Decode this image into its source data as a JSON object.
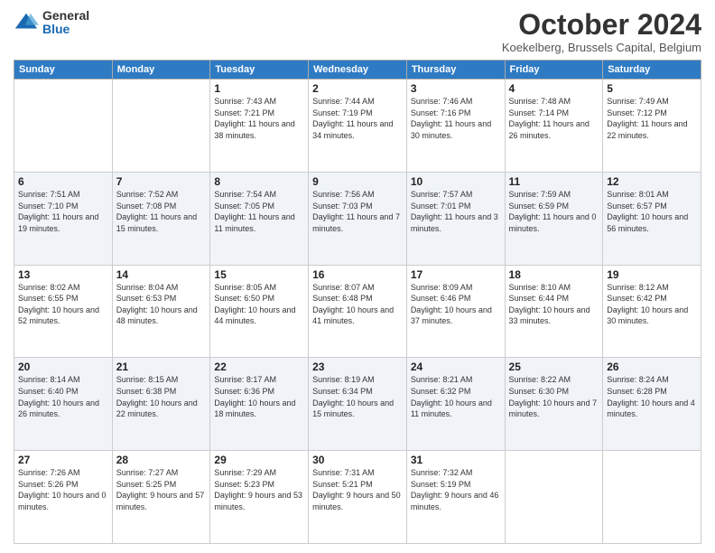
{
  "header": {
    "logo_general": "General",
    "logo_blue": "Blue",
    "month_title": "October 2024",
    "location": "Koekelberg, Brussels Capital, Belgium"
  },
  "weekdays": [
    "Sunday",
    "Monday",
    "Tuesday",
    "Wednesday",
    "Thursday",
    "Friday",
    "Saturday"
  ],
  "weeks": [
    [
      {
        "day": "",
        "sunrise": "",
        "sunset": "",
        "daylight": ""
      },
      {
        "day": "",
        "sunrise": "",
        "sunset": "",
        "daylight": ""
      },
      {
        "day": "1",
        "sunrise": "Sunrise: 7:43 AM",
        "sunset": "Sunset: 7:21 PM",
        "daylight": "Daylight: 11 hours and 38 minutes."
      },
      {
        "day": "2",
        "sunrise": "Sunrise: 7:44 AM",
        "sunset": "Sunset: 7:19 PM",
        "daylight": "Daylight: 11 hours and 34 minutes."
      },
      {
        "day": "3",
        "sunrise": "Sunrise: 7:46 AM",
        "sunset": "Sunset: 7:16 PM",
        "daylight": "Daylight: 11 hours and 30 minutes."
      },
      {
        "day": "4",
        "sunrise": "Sunrise: 7:48 AM",
        "sunset": "Sunset: 7:14 PM",
        "daylight": "Daylight: 11 hours and 26 minutes."
      },
      {
        "day": "5",
        "sunrise": "Sunrise: 7:49 AM",
        "sunset": "Sunset: 7:12 PM",
        "daylight": "Daylight: 11 hours and 22 minutes."
      }
    ],
    [
      {
        "day": "6",
        "sunrise": "Sunrise: 7:51 AM",
        "sunset": "Sunset: 7:10 PM",
        "daylight": "Daylight: 11 hours and 19 minutes."
      },
      {
        "day": "7",
        "sunrise": "Sunrise: 7:52 AM",
        "sunset": "Sunset: 7:08 PM",
        "daylight": "Daylight: 11 hours and 15 minutes."
      },
      {
        "day": "8",
        "sunrise": "Sunrise: 7:54 AM",
        "sunset": "Sunset: 7:05 PM",
        "daylight": "Daylight: 11 hours and 11 minutes."
      },
      {
        "day": "9",
        "sunrise": "Sunrise: 7:56 AM",
        "sunset": "Sunset: 7:03 PM",
        "daylight": "Daylight: 11 hours and 7 minutes."
      },
      {
        "day": "10",
        "sunrise": "Sunrise: 7:57 AM",
        "sunset": "Sunset: 7:01 PM",
        "daylight": "Daylight: 11 hours and 3 minutes."
      },
      {
        "day": "11",
        "sunrise": "Sunrise: 7:59 AM",
        "sunset": "Sunset: 6:59 PM",
        "daylight": "Daylight: 11 hours and 0 minutes."
      },
      {
        "day": "12",
        "sunrise": "Sunrise: 8:01 AM",
        "sunset": "Sunset: 6:57 PM",
        "daylight": "Daylight: 10 hours and 56 minutes."
      }
    ],
    [
      {
        "day": "13",
        "sunrise": "Sunrise: 8:02 AM",
        "sunset": "Sunset: 6:55 PM",
        "daylight": "Daylight: 10 hours and 52 minutes."
      },
      {
        "day": "14",
        "sunrise": "Sunrise: 8:04 AM",
        "sunset": "Sunset: 6:53 PM",
        "daylight": "Daylight: 10 hours and 48 minutes."
      },
      {
        "day": "15",
        "sunrise": "Sunrise: 8:05 AM",
        "sunset": "Sunset: 6:50 PM",
        "daylight": "Daylight: 10 hours and 44 minutes."
      },
      {
        "day": "16",
        "sunrise": "Sunrise: 8:07 AM",
        "sunset": "Sunset: 6:48 PM",
        "daylight": "Daylight: 10 hours and 41 minutes."
      },
      {
        "day": "17",
        "sunrise": "Sunrise: 8:09 AM",
        "sunset": "Sunset: 6:46 PM",
        "daylight": "Daylight: 10 hours and 37 minutes."
      },
      {
        "day": "18",
        "sunrise": "Sunrise: 8:10 AM",
        "sunset": "Sunset: 6:44 PM",
        "daylight": "Daylight: 10 hours and 33 minutes."
      },
      {
        "day": "19",
        "sunrise": "Sunrise: 8:12 AM",
        "sunset": "Sunset: 6:42 PM",
        "daylight": "Daylight: 10 hours and 30 minutes."
      }
    ],
    [
      {
        "day": "20",
        "sunrise": "Sunrise: 8:14 AM",
        "sunset": "Sunset: 6:40 PM",
        "daylight": "Daylight: 10 hours and 26 minutes."
      },
      {
        "day": "21",
        "sunrise": "Sunrise: 8:15 AM",
        "sunset": "Sunset: 6:38 PM",
        "daylight": "Daylight: 10 hours and 22 minutes."
      },
      {
        "day": "22",
        "sunrise": "Sunrise: 8:17 AM",
        "sunset": "Sunset: 6:36 PM",
        "daylight": "Daylight: 10 hours and 18 minutes."
      },
      {
        "day": "23",
        "sunrise": "Sunrise: 8:19 AM",
        "sunset": "Sunset: 6:34 PM",
        "daylight": "Daylight: 10 hours and 15 minutes."
      },
      {
        "day": "24",
        "sunrise": "Sunrise: 8:21 AM",
        "sunset": "Sunset: 6:32 PM",
        "daylight": "Daylight: 10 hours and 11 minutes."
      },
      {
        "day": "25",
        "sunrise": "Sunrise: 8:22 AM",
        "sunset": "Sunset: 6:30 PM",
        "daylight": "Daylight: 10 hours and 7 minutes."
      },
      {
        "day": "26",
        "sunrise": "Sunrise: 8:24 AM",
        "sunset": "Sunset: 6:28 PM",
        "daylight": "Daylight: 10 hours and 4 minutes."
      }
    ],
    [
      {
        "day": "27",
        "sunrise": "Sunrise: 7:26 AM",
        "sunset": "Sunset: 5:26 PM",
        "daylight": "Daylight: 10 hours and 0 minutes."
      },
      {
        "day": "28",
        "sunrise": "Sunrise: 7:27 AM",
        "sunset": "Sunset: 5:25 PM",
        "daylight": "Daylight: 9 hours and 57 minutes."
      },
      {
        "day": "29",
        "sunrise": "Sunrise: 7:29 AM",
        "sunset": "Sunset: 5:23 PM",
        "daylight": "Daylight: 9 hours and 53 minutes."
      },
      {
        "day": "30",
        "sunrise": "Sunrise: 7:31 AM",
        "sunset": "Sunset: 5:21 PM",
        "daylight": "Daylight: 9 hours and 50 minutes."
      },
      {
        "day": "31",
        "sunrise": "Sunrise: 7:32 AM",
        "sunset": "Sunset: 5:19 PM",
        "daylight": "Daylight: 9 hours and 46 minutes."
      },
      {
        "day": "",
        "sunrise": "",
        "sunset": "",
        "daylight": ""
      },
      {
        "day": "",
        "sunrise": "",
        "sunset": "",
        "daylight": ""
      }
    ]
  ]
}
